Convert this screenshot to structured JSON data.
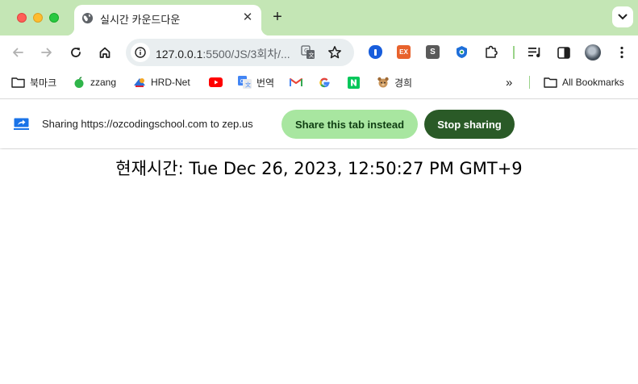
{
  "window": {
    "traffic_lights": [
      "close",
      "minimize",
      "maximize"
    ]
  },
  "tab": {
    "title": "실시간 카운드다운",
    "favicon": "globe-icon",
    "close_glyph": "✕"
  },
  "new_tab_glyph": "+",
  "toolbar": {
    "url_host": "127.0.0.1",
    "url_rest": ":5500/JS/3회차/...",
    "icons": [
      "back-arrow-icon",
      "forward-arrow-icon",
      "reload-icon",
      "home-icon",
      "site-info-icon",
      "translate-icon",
      "star-icon"
    ],
    "extensions": [
      {
        "name": "bitwarden-extension-icon",
        "glyph": "▮",
        "color": "#175ddc"
      },
      {
        "name": "ex-extension-icon",
        "glyph": "EX",
        "color": "#e8622c"
      },
      {
        "name": "s-extension-icon",
        "glyph": "S",
        "color": "#5a5a5a"
      },
      {
        "name": "shield-extension-icon",
        "glyph": "◆",
        "color": "#1e6fd9"
      },
      {
        "name": "puzzle-extensions-icon",
        "glyph": "",
        "color": "#444444"
      }
    ]
  },
  "bookmarks": {
    "items": [
      {
        "label": "북마크",
        "icon": "folder-icon"
      },
      {
        "label": "zzang",
        "icon": "apple-icon"
      },
      {
        "label": "HRD-Net",
        "icon": "hrd-icon"
      },
      {
        "label": "",
        "icon": "youtube-icon"
      },
      {
        "label": "번역",
        "icon": "google-translate-icon"
      },
      {
        "label": "",
        "icon": "gmail-icon"
      },
      {
        "label": "",
        "icon": "google-icon"
      },
      {
        "label": "",
        "icon": "naver-icon"
      },
      {
        "label": "경희",
        "icon": "khu-icon"
      }
    ],
    "overflow_glyph": "»",
    "all_bookmarks": "All Bookmarks"
  },
  "sharebar": {
    "message": "Sharing https://ozcodingschool.com to zep.us",
    "share_tab_button": "Share this tab instead",
    "stop_button": "Stop sharing",
    "share_tab_color": "#a8e6a0",
    "stop_color": "#2a5a27"
  },
  "page": {
    "clock_text": "현재시간: Tue Dec 26, 2023, 12:50:27 PM GMT+9"
  },
  "colors": {
    "tabstrip": "#c4e6b5",
    "omnibox": "#e9eef0"
  }
}
